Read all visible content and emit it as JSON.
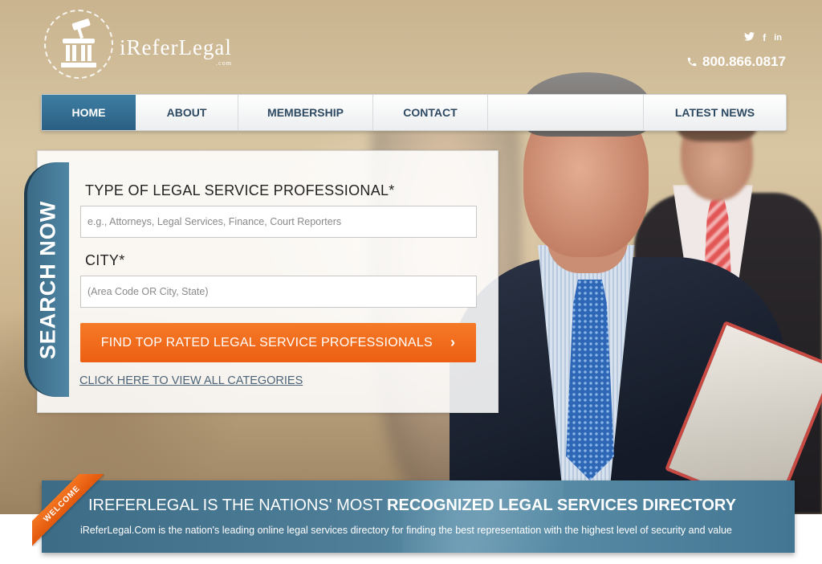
{
  "brand": {
    "name": "iReferLegal",
    "suffix": ".com"
  },
  "header": {
    "social": [
      "twitter-icon",
      "facebook-icon",
      "linkedin-icon"
    ],
    "phone": "800.866.0817"
  },
  "nav": {
    "items": [
      {
        "label": "HOME",
        "active": true
      },
      {
        "label": "ABOUT",
        "active": false
      },
      {
        "label": "MEMBERSHIP",
        "active": false
      },
      {
        "label": "CONTACT",
        "active": false
      },
      {
        "label": "LATEST NEWS",
        "active": false
      }
    ]
  },
  "search": {
    "tab_label": "SEARCH NOW",
    "type_label": "TYPE OF LEGAL SERVICE PROFESSIONAL*",
    "type_placeholder": "e.g., Attorneys, Legal Services, Finance, Court Reporters",
    "city_label": "CITY*",
    "city_placeholder": "(Area Code OR City, State)",
    "button_label": "FIND TOP RATED LEGAL SERVICE PROFESSIONALS",
    "button_chevron": "›",
    "all_categories_link": "CLICK HERE TO VIEW ALL CATEGORIES"
  },
  "welcome": {
    "ribbon": "WELCOME",
    "title_prefix": "IREFERLEGAL IS THE NATIONS' MOST ",
    "title_emphasis": "RECOGNIZED LEGAL SERVICES DIRECTORY",
    "subtitle": "iReferLegal.Com is the nation's leading online legal services directory for finding the best representation with the highest level of security and value"
  },
  "colors": {
    "nav_active": "#2f6a8e",
    "cta": "#f26a1b",
    "welcome_bar": "#4a7b96"
  }
}
